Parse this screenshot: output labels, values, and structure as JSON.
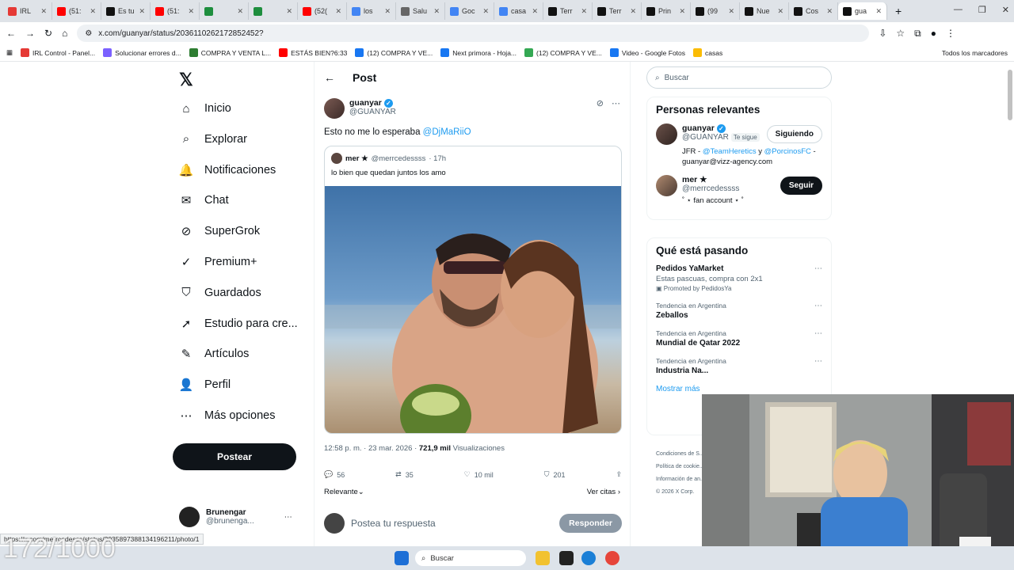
{
  "browser": {
    "tabs": [
      {
        "label": "IRL",
        "color": "#e53935"
      },
      {
        "label": "(51:",
        "color": "#ff0000"
      },
      {
        "label": "Es tu",
        "color": "#111111"
      },
      {
        "label": "(51:",
        "color": "#ff0000"
      },
      {
        "label": "",
        "color": "#1e8e3e"
      },
      {
        "label": "",
        "color": "#1e8e3e"
      },
      {
        "label": "(52(",
        "color": "#ff0000"
      },
      {
        "label": "los",
        "color": "#4285f4"
      },
      {
        "label": "Salu",
        "color": "#666666"
      },
      {
        "label": "Goc",
        "color": "#4285f4"
      },
      {
        "label": "casa",
        "color": "#4285f4"
      },
      {
        "label": "Terr",
        "color": "#111111"
      },
      {
        "label": "Terr",
        "color": "#111111"
      },
      {
        "label": "Prin",
        "color": "#111111"
      },
      {
        "label": "(99",
        "color": "#111111"
      },
      {
        "label": "Nue",
        "color": "#111111"
      },
      {
        "label": "Cos",
        "color": "#111111"
      },
      {
        "label": "gua",
        "color": "#111111",
        "active": true
      }
    ],
    "url": "x.com/guanyar/status/2036110262172852452?",
    "bookmarks": [
      "IRL Control - Panel...",
      "Solucionar errores d...",
      "COMPRA Y VENTA L...",
      "ESTÁS BIEN?6:33",
      "(12) COMPRA Y VE...",
      "Next primora - Hoja...",
      "(12) COMPRA Y VE...",
      "Video - Google Fotos",
      "casas"
    ],
    "all_bookmarks": "Todos los marcadores",
    "status_url": "https://x.com/merrcedesss/status/2035897388134196211/photo/1"
  },
  "nav": {
    "items": [
      {
        "label": "Inicio",
        "icon": "home-icon",
        "glyph": "⌂"
      },
      {
        "label": "Explorar",
        "icon": "search-icon",
        "glyph": "⌕"
      },
      {
        "label": "Notificaciones",
        "icon": "bell-icon",
        "glyph": "🔔"
      },
      {
        "label": "Chat",
        "icon": "mail-icon",
        "glyph": "✉"
      },
      {
        "label": "SuperGrok",
        "icon": "grok-icon",
        "glyph": "⊘"
      },
      {
        "label": "Premium+",
        "icon": "premium-icon",
        "glyph": "✓"
      },
      {
        "label": "Guardados",
        "icon": "bookmark-icon",
        "glyph": "⛉"
      },
      {
        "label": "Estudio para cre...",
        "icon": "rocket-icon",
        "glyph": "➚"
      },
      {
        "label": "Artículos",
        "icon": "article-icon",
        "glyph": "✎"
      },
      {
        "label": "Perfil",
        "icon": "profile-icon",
        "glyph": "👤"
      },
      {
        "label": "Más opciones",
        "icon": "more-icon",
        "glyph": "⋯"
      }
    ],
    "post_button": "Postear",
    "account_name": "Brunengar",
    "account_handle": "@brunenga..."
  },
  "post": {
    "header": "Post",
    "author_name": "guanyar",
    "author_handle": "@GUANYAR",
    "text": "Esto no me lo esperaba ",
    "mention": "@DjMaRiiO",
    "quote": {
      "author_name": "mer ★",
      "author_handle": "@merrcedessss",
      "time": "· 17h",
      "text": "lo bien que quedan juntos los amo"
    },
    "timestamp": "12:58 p. m. · 23 mar. 2026 · ",
    "views": "721,9 mil",
    "views_label": " Visualizaciones",
    "replies": "56",
    "reposts": "35",
    "likes": "10 mil",
    "bookmarks": "201",
    "relevant": "Relevante",
    "citations": "Ver citas",
    "reply_placeholder": "Postea tu respuesta",
    "reply_button": "Responder"
  },
  "sidebar": {
    "search_placeholder": "Buscar",
    "relevant_title": "Personas relevantes",
    "people": [
      {
        "name": "guanyar",
        "handle": "@GUANYAR",
        "follows_you": "Te sigue",
        "button": "Siguiendo",
        "bio_start": "JFR - ",
        "bio_link1": "@TeamHeretics",
        "bio_mid": " y ",
        "bio_link2": "@PorcinosFC",
        "bio_end": " - guanyar@vizz-agency.com"
      },
      {
        "name": "mer ★",
        "handle": "@merrcedessss",
        "button": "Seguir",
        "bio": "˚ ⋆ fan account ⋆ ˚"
      }
    ],
    "trends_title": "Qué está pasando",
    "promo": {
      "title": "Pedidos YaMarket",
      "subtitle": "Estas pascuas, compra con 2x1",
      "promoted": "Promoted by PedidosYa"
    },
    "trends": [
      {
        "context": "Tendencia en Argentina",
        "topic": "Zeballos"
      },
      {
        "context": "Tendencia en Argentina",
        "topic": "Mundial de Qatar 2022"
      },
      {
        "context": "Tendencia en Argentina",
        "topic": "Industria Na..."
      }
    ],
    "show_more": "Mostrar más",
    "footer": [
      "Condiciones de S...",
      "Política de cookie...",
      "Información de an...",
      "© 2026 X Corp."
    ]
  },
  "overlay": {
    "counter": "172/1000"
  },
  "taskbar": {
    "search": "Buscar"
  }
}
